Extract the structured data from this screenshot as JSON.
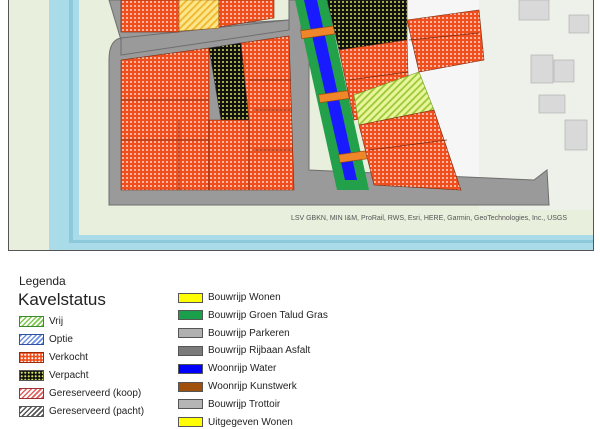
{
  "map": {
    "attribution": "LSV GBKN, MIN I&M, ProRail, RWS, Esri, HERE, Garmin, GeoTechnologies, Inc., USGS",
    "colors": {
      "water": "#a9dbe8",
      "grass": "#e8efdc",
      "road": "#9a9a9a",
      "sold": "#f04e1c",
      "verpacht": "#111111",
      "vrij_stripe": "#c9e070",
      "yellow": "#f2d45a",
      "green_talud": "#22a04a",
      "water_blue": "#1a1aff",
      "orange_bridge": "#f0862a"
    }
  },
  "legend": {
    "title": "Legenda",
    "heading": "Kavelstatus",
    "status_items": [
      {
        "label": "Vrij",
        "icon": "vrij-swatch"
      },
      {
        "label": "Optie",
        "icon": "optie-swatch"
      },
      {
        "label": "Verkocht",
        "icon": "verkocht-swatch"
      },
      {
        "label": "Verpacht",
        "icon": "verpacht-swatch"
      },
      {
        "label": "Gereserveerd (koop)",
        "icon": "gereserveerd-koop-swatch"
      },
      {
        "label": "Gereserveerd (pacht)",
        "icon": "gereserveerd-pacht-swatch"
      }
    ],
    "layer_items": [
      {
        "label": "Bouwrijp Wonen",
        "color": "#ffff00"
      },
      {
        "label": "Bouwrijp Groen Talud Gras",
        "color": "#1aa04a"
      },
      {
        "label": "Bouwrijp Parkeren",
        "color": "#b0b0b0"
      },
      {
        "label": "Bouwrijp Rijbaan Asfalt",
        "color": "#7a7a7a"
      },
      {
        "label": "Woonrijp Water",
        "color": "#0000ff"
      },
      {
        "label": "Woonrijp Kunstwerk",
        "color": "#a0500a"
      },
      {
        "label": "Bouwrijp Trottoir",
        "color": "#b5b5b5"
      },
      {
        "label": "Uitgegeven Wonen",
        "color": "#ffff00"
      }
    ]
  }
}
